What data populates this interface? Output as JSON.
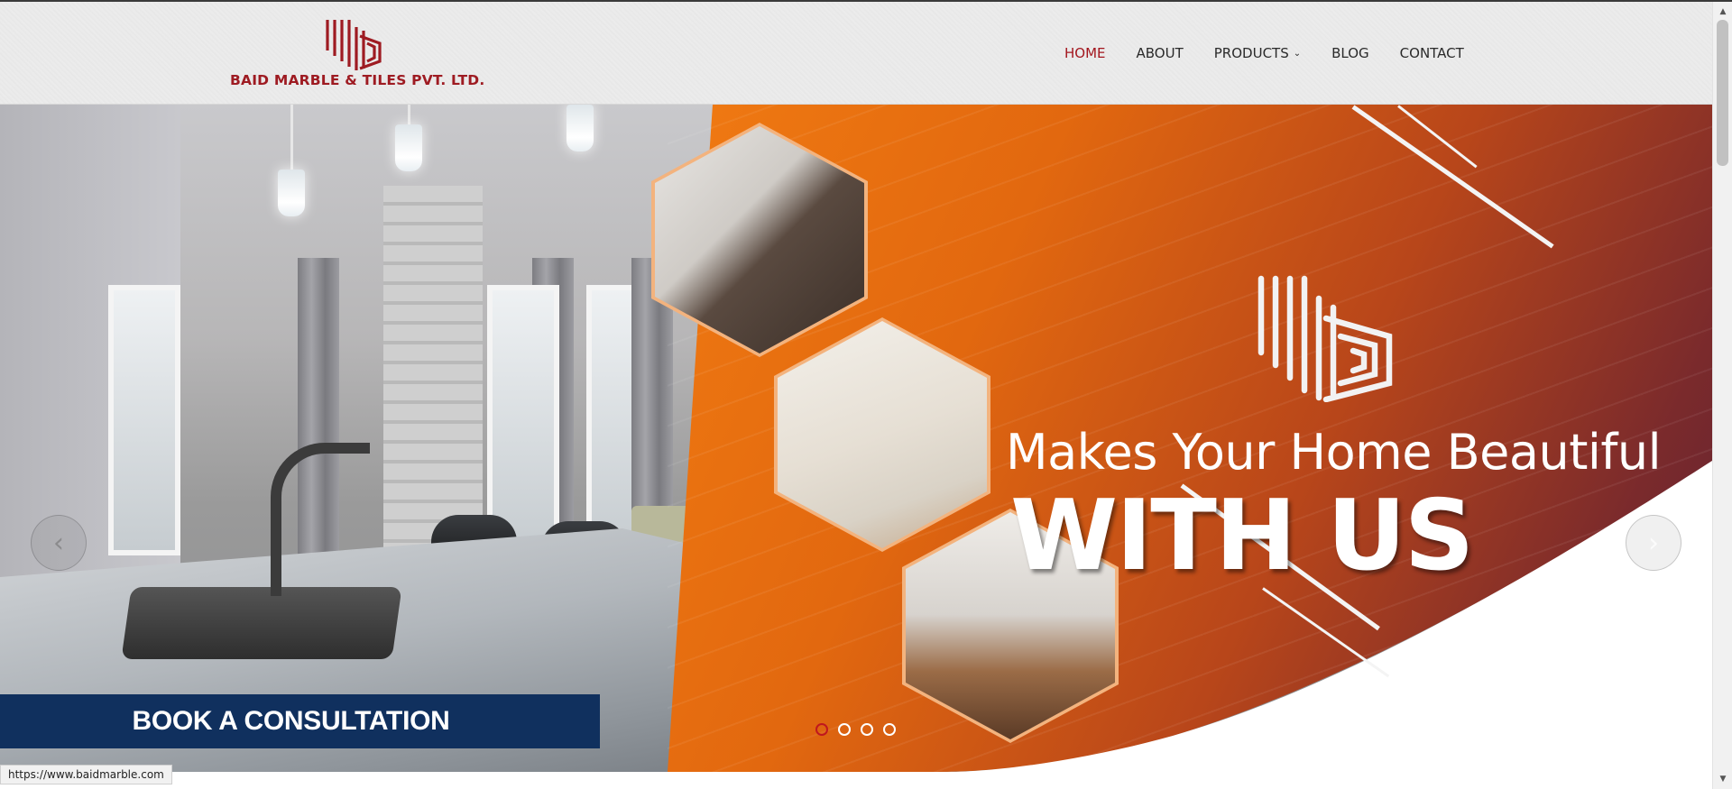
{
  "header": {
    "brand_name": "BAID MARBLE & TILES PVT. LTD.",
    "brand_color": "#9e1b22"
  },
  "nav": {
    "items": [
      {
        "label": "HOME",
        "active": true
      },
      {
        "label": "ABOUT",
        "active": false
      },
      {
        "label": "PRODUCTS",
        "active": false,
        "has_dropdown": true
      },
      {
        "label": "BLOG",
        "active": false
      },
      {
        "label": "CONTACT",
        "active": false
      }
    ],
    "active_color": "#a3161e"
  },
  "hero": {
    "headline_line1": "Makes Your Home Beautiful",
    "headline_line2": "WITH US",
    "prev_icon": "chevron-left-icon",
    "next_icon": "chevron-right-icon",
    "slide_count": 4,
    "active_slide": 1,
    "accent_colors": [
      "#f07a12",
      "#b8461a",
      "#5e2133"
    ]
  },
  "cta": {
    "label": "BOOK A CONSULTATION",
    "background": "#10305e"
  },
  "status_bar": {
    "url": "https://www.baidmarble.com"
  }
}
